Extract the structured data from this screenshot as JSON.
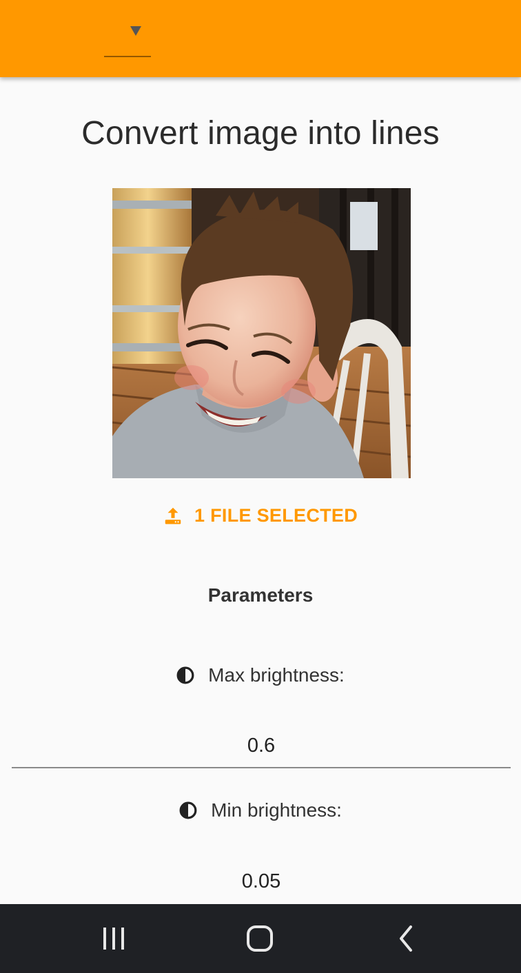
{
  "appbar": {
    "language_value": "",
    "accent_color": "#ff9800"
  },
  "page": {
    "title": "Convert image into lines"
  },
  "upload": {
    "label": "1 FILE SELECTED",
    "icon": "upload-icon"
  },
  "parameters": {
    "heading": "Parameters",
    "max_brightness": {
      "label": "Max brightness:",
      "value": "0.6",
      "icon": "contrast-icon"
    },
    "min_brightness": {
      "label": "Min brightness:",
      "value": "0.05",
      "icon": "contrast-icon"
    }
  },
  "navbar": {
    "recents_icon": "recents-icon",
    "home_icon": "home-icon",
    "back_icon": "back-icon"
  }
}
